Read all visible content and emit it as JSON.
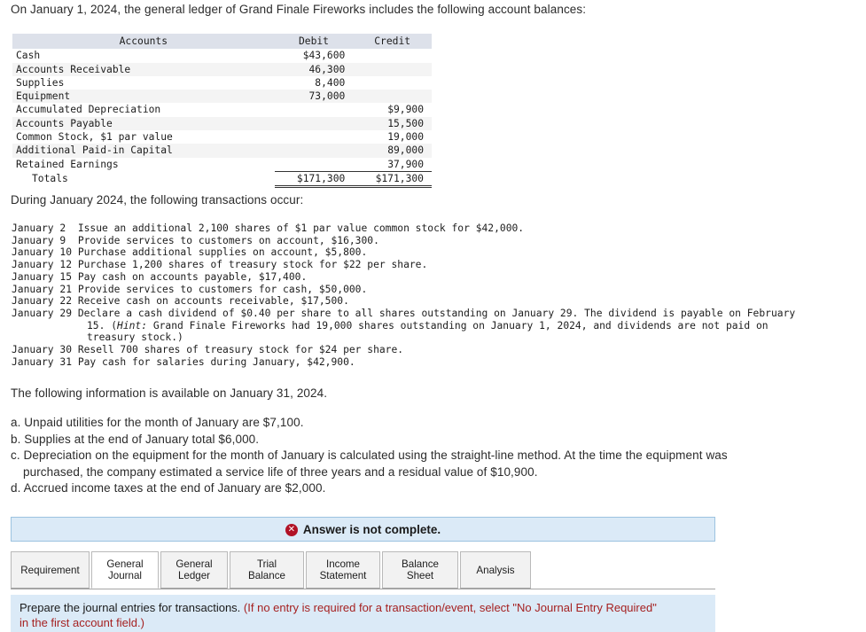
{
  "intro": "On January 1, 2024, the general ledger of Grand Finale Fireworks includes the following account balances:",
  "ledger": {
    "columns": [
      "Accounts",
      "Debit",
      "Credit"
    ],
    "rows": [
      {
        "account": "Cash",
        "debit": "$43,600",
        "credit": ""
      },
      {
        "account": "Accounts Receivable",
        "debit": "46,300",
        "credit": ""
      },
      {
        "account": "Supplies",
        "debit": "8,400",
        "credit": ""
      },
      {
        "account": "Equipment",
        "debit": "73,000",
        "credit": ""
      },
      {
        "account": "Accumulated Depreciation",
        "debit": "",
        "credit": "$9,900"
      },
      {
        "account": "Accounts Payable",
        "debit": "",
        "credit": "15,500"
      },
      {
        "account": "Common Stock, $1 par value",
        "debit": "",
        "credit": "19,000"
      },
      {
        "account": "Additional Paid-in Capital",
        "debit": "",
        "credit": "89,000"
      },
      {
        "account": "Retained Earnings",
        "debit": "",
        "credit": "37,900"
      }
    ],
    "totals": {
      "label": "Totals",
      "debit": "$171,300",
      "credit": "$171,300"
    }
  },
  "during_heading": "During January 2024, the following transactions occur:",
  "transactions": [
    {
      "date": "January 2 ",
      "text": "Issue an additional 2,100 shares of $1 par value common stock for $42,000."
    },
    {
      "date": "January 9 ",
      "text": "Provide services to customers on account, $16,300."
    },
    {
      "date": "January 10",
      "text": "Purchase additional supplies on account, $5,800."
    },
    {
      "date": "January 12",
      "text": "Purchase 1,200 shares of treasury stock for $22 per share."
    },
    {
      "date": "January 15",
      "text": "Pay cash on accounts payable, $17,400."
    },
    {
      "date": "January 21",
      "text": "Provide services to customers for cash, $50,000."
    },
    {
      "date": "January 22",
      "text": "Receive cash on accounts receivable, $17,500."
    },
    {
      "date": "January 29",
      "text": "Declare a cash dividend of $0.40 per share to all shares outstanding on January 29. The dividend is payable on February"
    },
    {
      "date": "January 30",
      "text": "Resell 700 shares of treasury stock for $24 per share."
    },
    {
      "date": "January 31",
      "text": "Pay cash for salaries during January, $42,900."
    }
  ],
  "jan29_continuation": {
    "line2_pre": "15. (",
    "line2_hint": "Hint:",
    "line2_post": " Grand Finale Fireworks had 19,000 shares outstanding on January 1, 2024, and dividends are not paid on",
    "line3": "treasury stock.)"
  },
  "following_heading": "The following information is available on January 31, 2024.",
  "adjusting_items": [
    {
      "line1": "a. Unpaid utilities for the month of January are $7,100.",
      "line2": ""
    },
    {
      "line1": "b. Supplies at the end of January total $6,000.",
      "line2": ""
    },
    {
      "line1": "c. Depreciation on the equipment for the month of January is calculated using the straight-line method. At the time the equipment was",
      "line2": "purchased, the company estimated a service life of three years and a residual value of $10,900."
    },
    {
      "line1": "d. Accrued income taxes at the end of January are $2,000.",
      "line2": ""
    }
  ],
  "answer_banner": {
    "icon": "error-x-icon",
    "icon_glyph": "✕",
    "message": "Answer is not complete.",
    "background": "#dbeaf7",
    "icon_color": "#b11226"
  },
  "tabs": [
    {
      "label": "Requirement",
      "active": false
    },
    {
      "label": "General Journal",
      "active": true
    },
    {
      "label": "General Ledger",
      "active": false
    },
    {
      "label": "Trial Balance",
      "active": false
    },
    {
      "label": "Income Statement",
      "active": false
    },
    {
      "label": "Balance Sheet",
      "active": false
    },
    {
      "label": "Analysis",
      "active": false
    }
  ],
  "instruction": {
    "black_part": "Prepare the journal entries for transactions. ",
    "red_line1": "(If no entry is required for a transaction/event, select \"No Journal Entry Required\"",
    "red_line2": "in the first account field.)"
  }
}
